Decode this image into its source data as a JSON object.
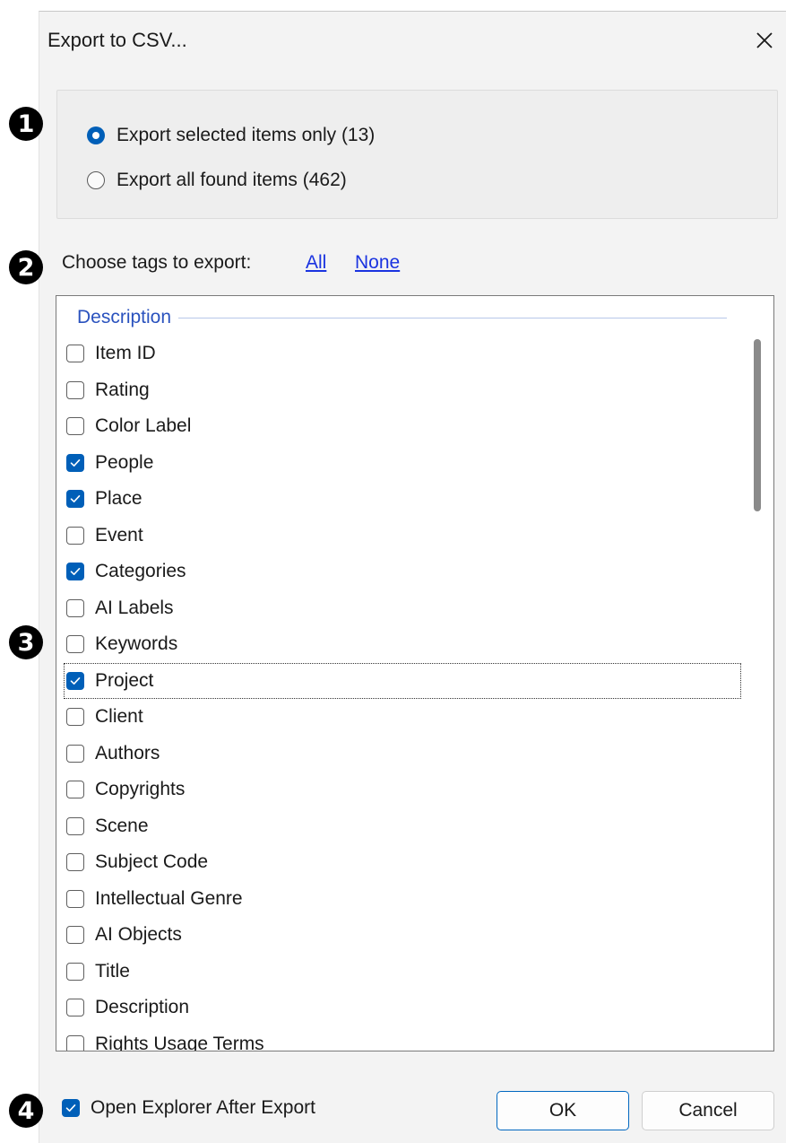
{
  "dialog": {
    "title": "Export to CSV...",
    "close_glyph": "✕"
  },
  "export_scope": {
    "options": [
      {
        "label": "Export selected items only (13)",
        "selected": true
      },
      {
        "label": "Export all found items (462)",
        "selected": false
      }
    ]
  },
  "tags": {
    "label": "Choose tags to export:",
    "all_link": "All",
    "none_link": "None",
    "group_header": "Description",
    "items": [
      {
        "label": "Item ID",
        "checked": false
      },
      {
        "label": "Rating",
        "checked": false
      },
      {
        "label": "Color Label",
        "checked": false
      },
      {
        "label": "People",
        "checked": true
      },
      {
        "label": "Place",
        "checked": true
      },
      {
        "label": "Event",
        "checked": false
      },
      {
        "label": "Categories",
        "checked": true
      },
      {
        "label": "AI Labels",
        "checked": false
      },
      {
        "label": "Keywords",
        "checked": false
      },
      {
        "label": "Project",
        "checked": true,
        "focused": true
      },
      {
        "label": "Client",
        "checked": false
      },
      {
        "label": "Authors",
        "checked": false
      },
      {
        "label": "Copyrights",
        "checked": false
      },
      {
        "label": "Scene",
        "checked": false
      },
      {
        "label": "Subject Code",
        "checked": false
      },
      {
        "label": "Intellectual Genre",
        "checked": false
      },
      {
        "label": "AI Objects",
        "checked": false
      },
      {
        "label": "Title",
        "checked": false
      },
      {
        "label": "Description",
        "checked": false
      },
      {
        "label": "Rights Usage Terms",
        "checked": false
      }
    ]
  },
  "footer": {
    "open_explorer_label": "Open Explorer After Export",
    "open_explorer_checked": true,
    "ok_label": "OK",
    "cancel_label": "Cancel"
  },
  "annotations": [
    "1",
    "2",
    "3",
    "4"
  ],
  "colors": {
    "accent": "#005fb8",
    "link": "#1a33e0",
    "group_header": "#2a52be",
    "dialog_bg": "#f3f3f3"
  }
}
